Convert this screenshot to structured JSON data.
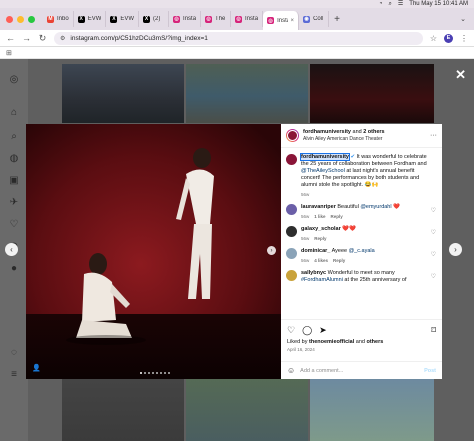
{
  "menubar": {
    "datetime": "Thu May 15  10:41 AM",
    "icons": [
      "wifi-icon",
      "search-icon",
      "control-center-icon",
      "siri-icon"
    ]
  },
  "tabs": [
    {
      "label": "Inbo",
      "icon": "gmail-icon",
      "color": "#ea4335",
      "glyph": "M"
    },
    {
      "label": "EVW",
      "icon": "x-icon",
      "color": "#000000",
      "glyph": "X"
    },
    {
      "label": "EVW",
      "icon": "x-icon",
      "color": "#000000",
      "glyph": "X"
    },
    {
      "label": "(2)",
      "icon": "x-icon",
      "color": "#000000",
      "glyph": "X"
    },
    {
      "label": "Insta",
      "icon": "instagram-icon",
      "color": "#d6247b",
      "glyph": "◎"
    },
    {
      "label": "The",
      "icon": "instagram-icon",
      "color": "#d6247b",
      "glyph": "◎"
    },
    {
      "label": "Insta",
      "icon": "instagram-icon",
      "color": "#d6247b",
      "glyph": "◎"
    },
    {
      "label": "Insta",
      "icon": "instagram-icon",
      "color": "#d6247b",
      "glyph": "◎",
      "active": true
    },
    {
      "label": "Coll",
      "icon": "chrome-ext-icon",
      "color": "#5b6bd6",
      "glyph": "◉"
    }
  ],
  "address": {
    "url": "instagram.com/p/C51hzDCu3mS/?img_index=1",
    "profile_initial": "E"
  },
  "post": {
    "account": "fordhamuniversity",
    "and": " and ",
    "others": "2 others",
    "location": "Alvin Ailey American Dance Theater",
    "caption_user": "fordhamuniversity",
    "caption_before": " It was wonderful to celebrate the 25 years of collaboration between Fordham and ",
    "caption_link": "@TheAileySchool",
    "caption_after": " at last night's annual benefit concert! The performances by both students and alumni stole the spotlight. 😂🙌",
    "caption_age": "56w",
    "comments": [
      {
        "user": "lauravanriper",
        "text": " Beautiful ",
        "mention": "@emyurdahl",
        "emoji": " ❤️",
        "age": "56w",
        "likes": "1 like",
        "reply": "Reply",
        "avatar_color": "#6b5fa8"
      },
      {
        "user": "galaxy_scholar",
        "text": " ",
        "mention": "",
        "emoji": "❤️❤️",
        "age": "56w",
        "likes": "",
        "reply": "Reply",
        "avatar_color": "#2e2e2e"
      },
      {
        "user": "dominicar_",
        "text": " Ayeee ",
        "mention": "@_c.ayala",
        "emoji": "",
        "age": "56w",
        "likes": "4 likes",
        "reply": "Reply",
        "avatar_color": "#8aa3b8"
      },
      {
        "user": "sallybnyc",
        "text": " Wonderful to meet so many ",
        "mention": "#FordhamAlumni",
        "emoji": " at the 25th anniversary of",
        "age": "",
        "likes": "",
        "reply": "",
        "avatar_color": "#c9a23a"
      }
    ],
    "liked_prefix": "Liked by ",
    "liked_user": "thenoemieofficial",
    "liked_and": " and ",
    "liked_others": "others",
    "date": "April 16, 2024",
    "add_comment_placeholder": "Add a comment...",
    "post_label": "Post"
  }
}
